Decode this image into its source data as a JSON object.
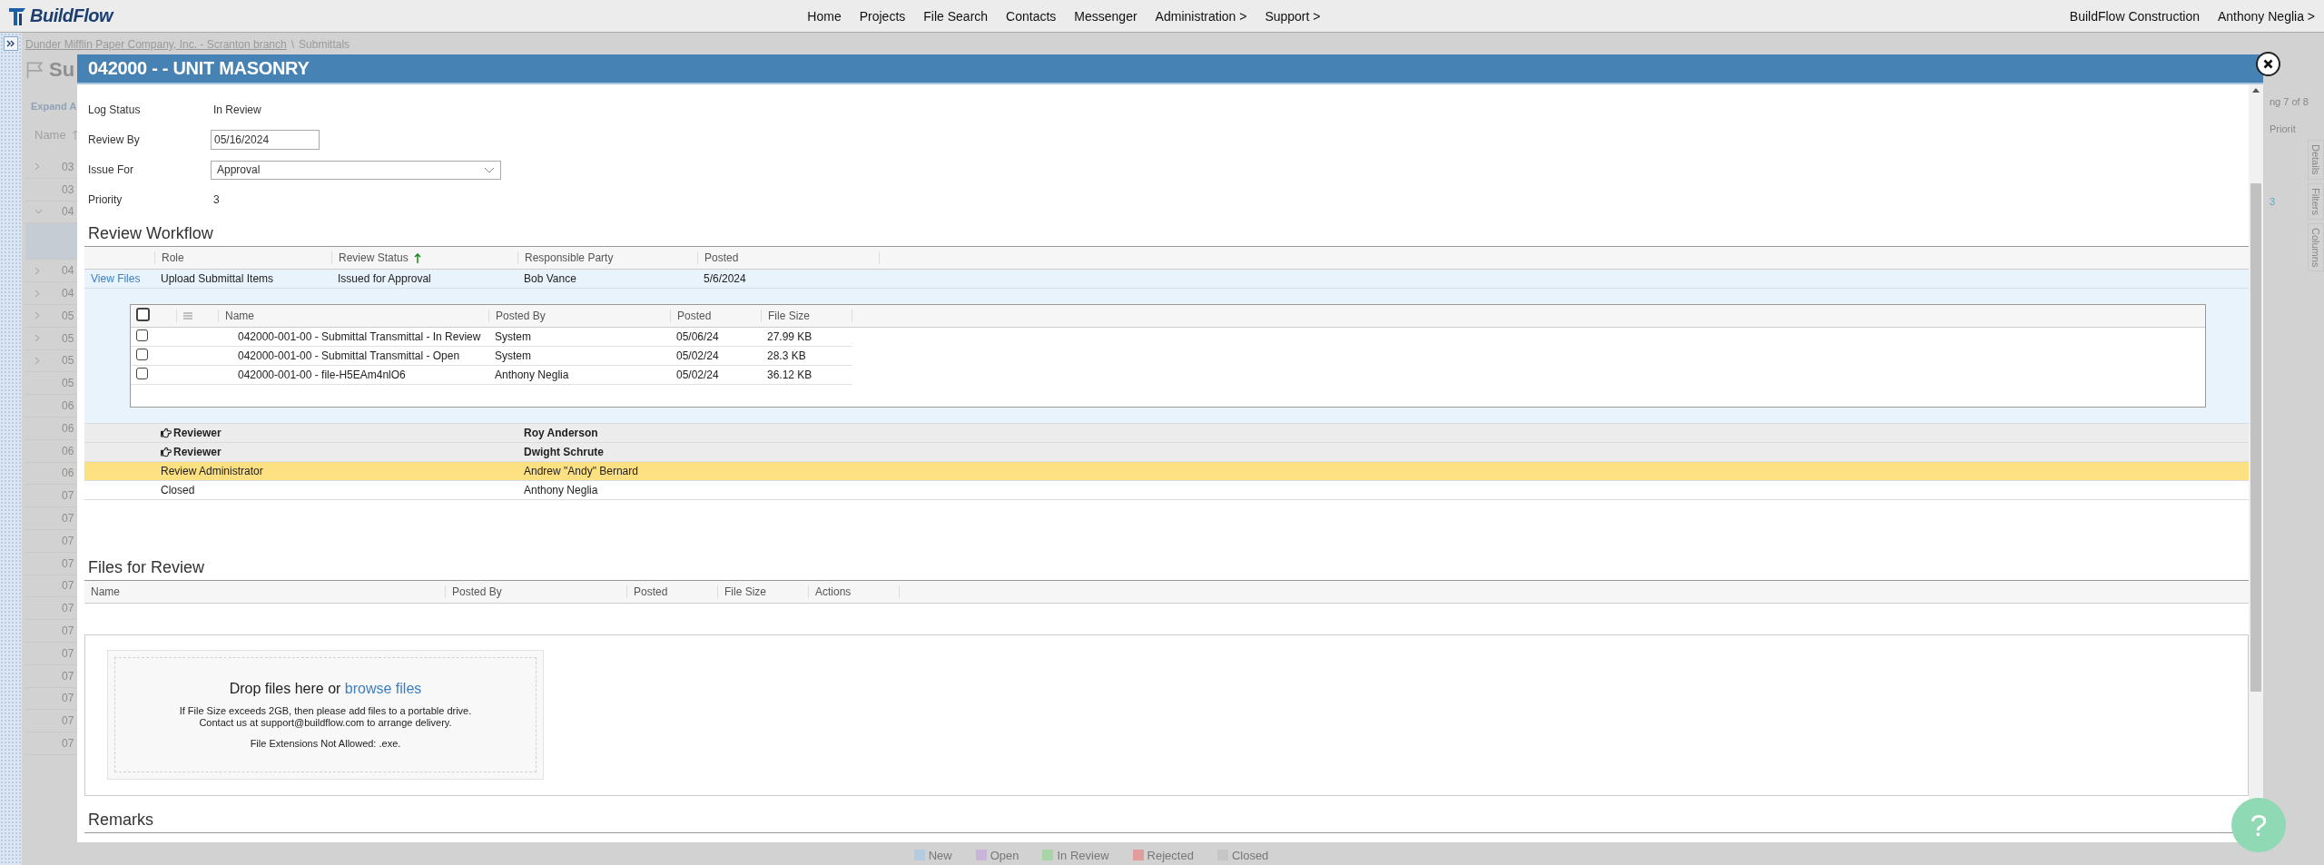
{
  "nav": {
    "logo": "BuildFlow",
    "links": [
      "Home",
      "Projects",
      "File Search",
      "Contacts",
      "Messenger",
      "Administration >",
      "Support >"
    ],
    "company": "BuildFlow Construction",
    "user": "Anthony Neglia >"
  },
  "background": {
    "breadcrumb_link": "Dunder Mifflin Paper Company, Inc. - Scranton branch",
    "breadcrumb_separator": "\\",
    "breadcrumb_current": "Submittals",
    "page_title": "Su",
    "expand_button": "Expand A",
    "name_column": "Name",
    "paging": "ng 7 of 8",
    "priority_column": "Priorit",
    "priority_cell": "3",
    "side_tabs": [
      "Details",
      "Filters",
      "Columns"
    ],
    "rows": [
      {
        "code": "03",
        "expanded": false,
        "selected": false
      },
      {
        "code": "03",
        "selected": false
      },
      {
        "code": "04",
        "expanded": true,
        "selected": false
      },
      {
        "selected": true
      },
      {
        "code": "04",
        "expanded": false,
        "selected": false
      },
      {
        "code": "04",
        "expanded": false,
        "selected": false
      },
      {
        "code": "05",
        "expanded": false,
        "selected": false
      },
      {
        "code": "05",
        "expanded": false,
        "selected": false
      },
      {
        "code": "05",
        "expanded": false,
        "selected": false
      },
      {
        "code": "05",
        "selected": false
      },
      {
        "code": "06",
        "selected": false
      },
      {
        "code": "06",
        "selected": false
      },
      {
        "code": "06",
        "selected": false
      },
      {
        "code": "06",
        "selected": false
      },
      {
        "code": "07",
        "selected": false
      },
      {
        "code": "07",
        "selected": false
      },
      {
        "code": "07",
        "selected": false
      },
      {
        "code": "07",
        "selected": false
      },
      {
        "code": "07",
        "selected": false
      },
      {
        "code": "07",
        "selected": false
      },
      {
        "code": "07",
        "selected": false
      },
      {
        "code": "07",
        "selected": false
      },
      {
        "code": "07",
        "selected": false
      },
      {
        "code": "07",
        "selected": false
      },
      {
        "code": "07",
        "selected": false
      },
      {
        "code": "07",
        "selected": false
      }
    ],
    "legend": [
      {
        "label": "New",
        "color": "#b5cbe0"
      },
      {
        "label": "Open",
        "color": "#c9b5d8"
      },
      {
        "label": "In Review",
        "color": "#a8d4a8"
      },
      {
        "label": "Rejected",
        "color": "#e39c9c"
      },
      {
        "label": "Closed",
        "color": "#c6c6c6"
      }
    ]
  },
  "modal": {
    "title": "042000 - - UNIT MASONRY",
    "fields": [
      {
        "kind": "text",
        "label": "Log Status",
        "value": "In Review"
      },
      {
        "kind": "input",
        "label": "Review By",
        "value": "05/16/2024"
      },
      {
        "kind": "select",
        "label": "Issue For",
        "value": "Approval"
      },
      {
        "kind": "text",
        "label": "Priority",
        "value": "3"
      }
    ],
    "review_workflow": {
      "heading": "Review Workflow",
      "columns": [
        {
          "label": "Role",
          "sorted": false
        },
        {
          "label": "Review Status",
          "sorted": true
        },
        {
          "label": "Responsible Party",
          "sorted": false
        },
        {
          "label": "Posted",
          "sorted": false
        }
      ],
      "rows": [
        {
          "kind": "expanded",
          "selected": false,
          "action": "View Files",
          "role": "Upload Submittal Items",
          "status": "Issued for Approval",
          "party": "Bob Vance",
          "posted": "5/6/2024",
          "files": {
            "all_checked": false,
            "columns": [
              "Name",
              "Posted By",
              "Posted",
              "File Size"
            ],
            "rows": [
              {
                "checked": false,
                "name": "042000-001-00 - Submittal Transmittal - In Review",
                "posted_by": "System",
                "posted": "05/06/24",
                "size": "27.99 KB"
              },
              {
                "checked": false,
                "name": "042000-001-00 - Submittal Transmittal - Open",
                "posted_by": "System",
                "posted": "05/02/24",
                "size": "28.3 KB"
              },
              {
                "checked": false,
                "name": "042000-001-00 - file-H5EAm4nlO6",
                "posted_by": "Anthony Neglia",
                "posted": "05/02/24",
                "size": "36.12 KB"
              }
            ]
          }
        },
        {
          "kind": "reviewer",
          "selected": false,
          "role": "Reviewer",
          "party": "Roy Anderson"
        },
        {
          "kind": "reviewer",
          "selected": false,
          "role": "Reviewer",
          "party": "Dwight Schrute"
        },
        {
          "kind": "plain",
          "selected": true,
          "role": "Review Administrator",
          "party": "Andrew \"Andy\" Bernard"
        },
        {
          "kind": "plain",
          "selected": false,
          "role": "Closed",
          "party": "Anthony Neglia"
        }
      ]
    },
    "files_for_review": {
      "heading": "Files for Review",
      "columns": [
        "Name",
        "Posted By",
        "Posted",
        "File Size",
        "Actions"
      ],
      "dropzone": {
        "lead": "Drop files here or",
        "link": "browse files",
        "notes": [
          "If File Size exceeds 2GB, then please add files to a portable drive.",
          "Contact us at support@buildflow.com to arrange delivery."
        ],
        "extensions": "File Extensions Not Allowed: .exe."
      }
    },
    "remarks": {
      "heading": "Remarks"
    }
  },
  "help": "?"
}
